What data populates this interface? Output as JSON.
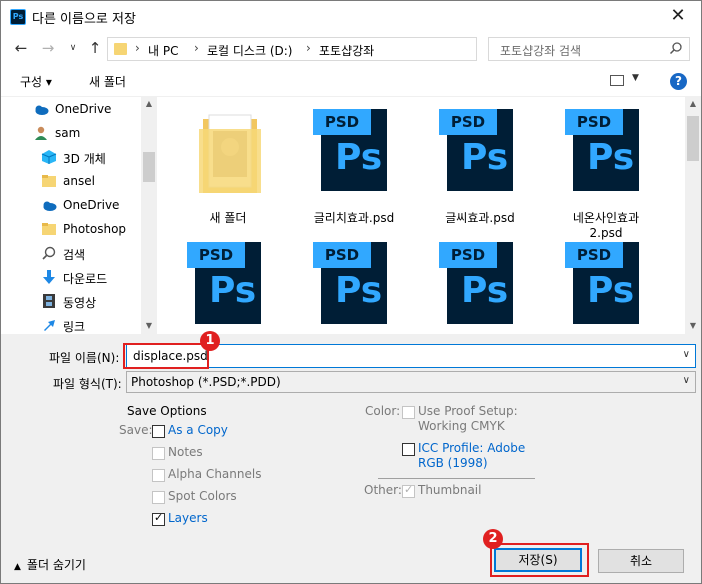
{
  "window": {
    "title": "다른 이름으로 저장",
    "app_icon": "Ps"
  },
  "address": {
    "crumbs": [
      "내 PC",
      "로컬 디스크 (D:)",
      "포토샵강좌"
    ],
    "search_placeholder": "포토샵강좌 검색"
  },
  "toolbar": {
    "organize": "구성 ▾",
    "new_folder": "새 폴더",
    "help": "?"
  },
  "nav_items": [
    "OneDrive",
    "sam",
    "3D 개체",
    "ansel",
    "OneDrive",
    "Photoshop",
    "검색",
    "다운로드",
    "동영상",
    "링크"
  ],
  "files": {
    "row1": [
      "새 폴더",
      "글리치효과.psd",
      "글씨효과.psd",
      "네온사인효과 2.psd"
    ],
    "psd_tab": "PSD",
    "ps_glyph": "Ps"
  },
  "form": {
    "filename_label": "파일 이름(N):",
    "filename_value": "displace.psd",
    "filetype_label": "파일 형식(T):",
    "filetype_value": "Photoshop (*.PSD;*.PDD)"
  },
  "save_options": {
    "heading": "Save Options",
    "save_label": "Save:",
    "as_a_copy": "As a Copy",
    "notes": "Notes",
    "alpha_channels": "Alpha Channels",
    "spot_colors": "Spot Colors",
    "layers": "Layers",
    "color_label": "Color:",
    "use_proof_1": "Use Proof Setup:",
    "use_proof_2": "Working CMYK",
    "icc_1": "ICC Profile:  Adobe",
    "icc_2": "RGB (1998)",
    "other_label": "Other:",
    "thumbnail": "Thumbnail"
  },
  "buttons": {
    "hide_folders": "폴더 숨기기",
    "save": "저장(S)",
    "cancel": "취소"
  },
  "annotations": {
    "badge1": "1",
    "badge2": "2"
  },
  "colors": {
    "accent": "#0078d7",
    "annotation_red": "#e02020",
    "ps_blue": "#31a8ff",
    "ps_navy": "#001e36"
  }
}
